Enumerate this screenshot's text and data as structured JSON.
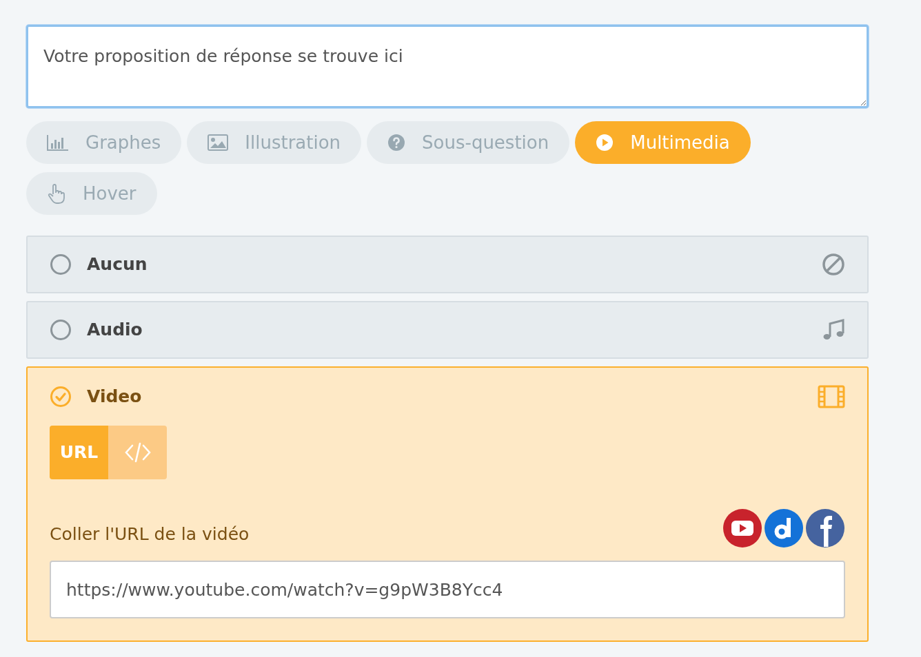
{
  "answer": {
    "value": "Votre proposition de réponse se trouve ici"
  },
  "tools": [
    {
      "label": "Graphes",
      "kind": "chart",
      "selected": false
    },
    {
      "label": "Illustration",
      "kind": "image",
      "selected": false
    },
    {
      "label": "Sous-question",
      "kind": "question",
      "selected": false
    },
    {
      "label": "Multimedia",
      "kind": "play",
      "selected": true
    },
    {
      "label": "Hover",
      "kind": "hand",
      "selected": false
    }
  ],
  "media_options": [
    {
      "label": "Aucun",
      "kind": "none",
      "selected": false
    },
    {
      "label": "Audio",
      "kind": "music",
      "selected": false
    },
    {
      "label": "Video",
      "kind": "film",
      "selected": true
    }
  ],
  "video": {
    "modes": [
      {
        "kind": "url",
        "label": "URL",
        "selected": true
      },
      {
        "kind": "embed",
        "selected": false
      }
    ],
    "url_label": "Coller l'URL de la vidéo",
    "url": {
      "value": "https://www.youtube.com/watch?v=g9pW3B8Ycc4"
    }
  }
}
